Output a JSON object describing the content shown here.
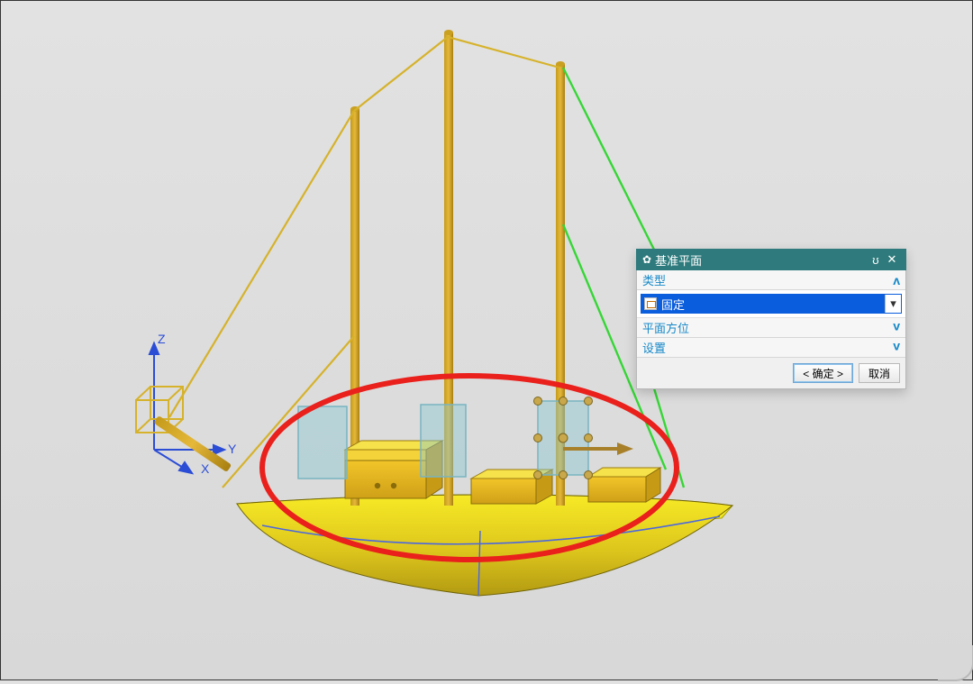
{
  "dialog": {
    "title": "基准平面",
    "sections": {
      "type": {
        "label": "类型",
        "value": "固定",
        "expanded": true
      },
      "orientation": {
        "label": "平面方位",
        "expanded": false
      },
      "settings": {
        "label": "设置",
        "expanded": false
      }
    },
    "ok": "< 确定 >",
    "cancel": "取消"
  },
  "axes": {
    "x": "X",
    "y": "Y",
    "z": "Z"
  },
  "viewport": {
    "model": "sailboat",
    "annotation": "red-circle-deck-planes",
    "datum_planes_count": 3
  }
}
